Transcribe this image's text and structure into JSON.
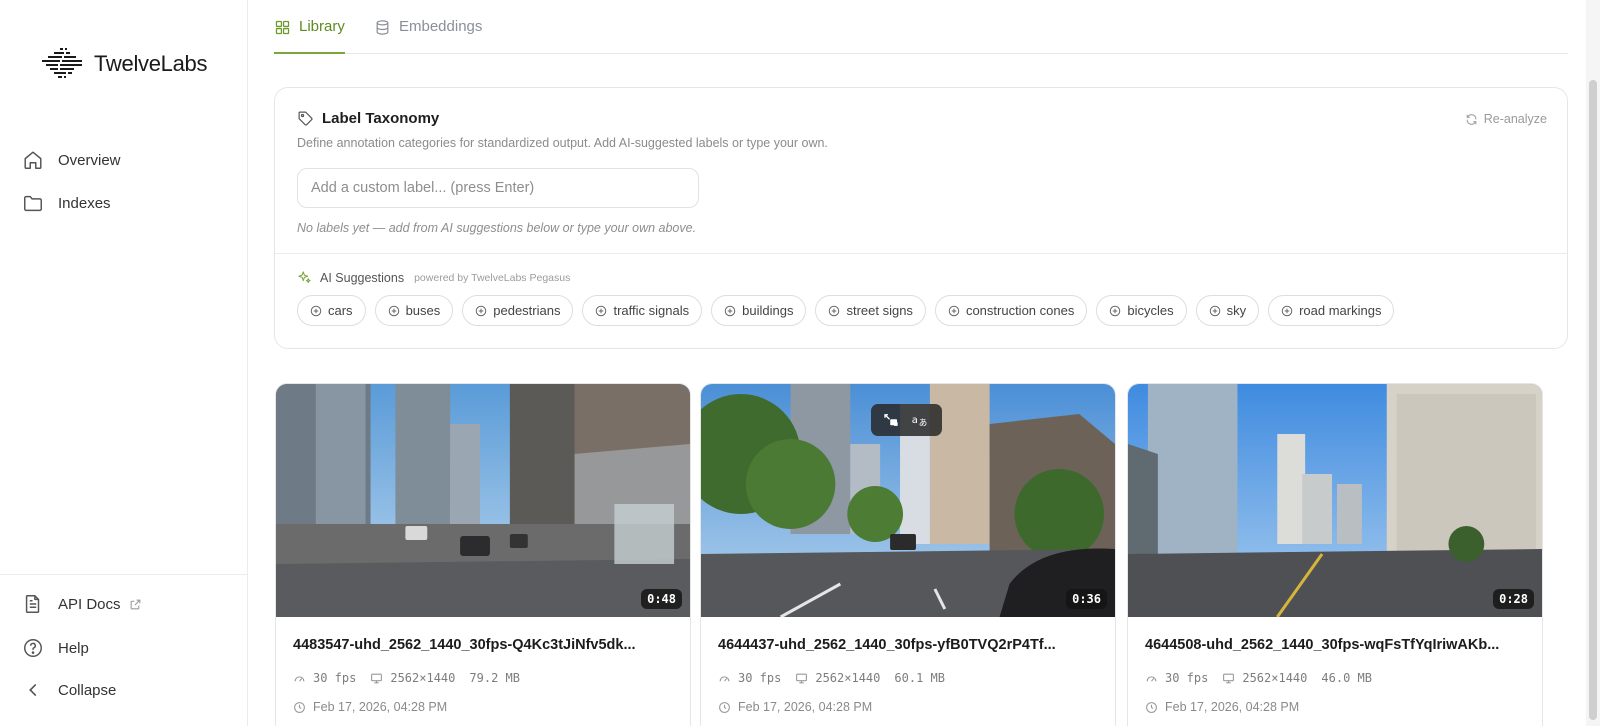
{
  "brand": {
    "name": "TwelveLabs"
  },
  "sidebar": {
    "nav": [
      {
        "label": "Overview",
        "icon": "home-icon"
      },
      {
        "label": "Indexes",
        "icon": "folder-icon"
      }
    ],
    "footer": [
      {
        "label": "API Docs",
        "icon": "document-icon"
      },
      {
        "label": "Help",
        "icon": "help-circle-icon"
      },
      {
        "label": "Collapse",
        "icon": "chevron-left-icon"
      }
    ]
  },
  "tabs": [
    {
      "label": "Library",
      "icon": "grid-icon",
      "active": true
    },
    {
      "label": "Embeddings",
      "icon": "database-icon",
      "active": false
    }
  ],
  "taxonomy": {
    "title": "Label Taxonomy",
    "description": "Define annotation categories for standardized output. Add AI-suggested labels or type your own.",
    "reanalyze_label": "Re-analyze",
    "input_placeholder": "Add a custom label... (press Enter)",
    "empty_note": "No labels yet — add from AI suggestions below or type your own above.",
    "suggestions_title": "AI Suggestions",
    "suggestions_powered": "powered by TwelveLabs Pegasus",
    "suggestions": [
      "cars",
      "buses",
      "pedestrians",
      "traffic signals",
      "buildings",
      "street signs",
      "construction cones",
      "bicycles",
      "sky",
      "road markings"
    ]
  },
  "videos": [
    {
      "title": "4483547-uhd_2562_1440_30fps-Q4Kc3tJiNfv5dk...",
      "duration": "0:48",
      "fps": "30 fps",
      "resolution": "2562×1440",
      "size": "79.2 MB",
      "date": "Feb 17, 2026, 04:28 PM"
    },
    {
      "title": "4644437-uhd_2562_1440_30fps-yfB0TVQ2rP4Tf...",
      "duration": "0:36",
      "fps": "30 fps",
      "resolution": "2562×1440",
      "size": "60.1 MB",
      "date": "Feb 17, 2026, 04:28 PM"
    },
    {
      "title": "4644508-uhd_2562_1440_30fps-wqFsTfYqIriwAKb...",
      "duration": "0:28",
      "fps": "30 fps",
      "resolution": "2562×1440",
      "size": "46.0 MB",
      "date": "Feb 17, 2026, 04:28 PM"
    }
  ],
  "colors": {
    "accent": "#7aa63a",
    "accent_text": "#5e8a1f"
  }
}
